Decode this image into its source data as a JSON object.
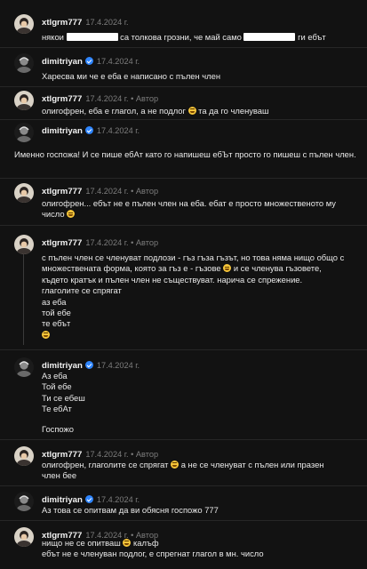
{
  "comments": [
    {
      "user": "xtlgrm777",
      "date": "17.4.2024 г.",
      "author": "",
      "lines": [
        "някои",
        "са толкова грозни, че май само",
        "ги ебът"
      ]
    },
    {
      "user": "dimitriyan",
      "date": "17.4.2024 г.",
      "author": "",
      "lines": [
        "Харесва ми че е еба е написано с пълен член"
      ]
    },
    {
      "user": "xtlgrm777",
      "date": "17.4.2024 г.",
      "author": "• Автор",
      "lines": [
        "олигофрен, еба е глагол, а не подлог",
        "та да го членуваш"
      ]
    },
    {
      "user": "dimitriyan",
      "date": "17.4.2024 г.",
      "author": "",
      "lines": [
        "Именно госпожа! И се пише ебАт като го напишеш ебЪт просто го пишеш с",
        "пълен член."
      ]
    },
    {
      "user": "xtlgrm777",
      "date": "17.4.2024 г.",
      "author": "• Автор",
      "lines": [
        "олигофрен... ебът не е пълен член на еба. ебат е просто множественото му",
        "число"
      ]
    },
    {
      "user": "xtlgrm777",
      "date": "17.4.2024 г.",
      "author": "• Автор",
      "lines": [
        "с пълен член се членуват подлози - гъз гъза гъзът, но това няма нищо общо с",
        "множествената форма, която за гъз е - гъзове",
        "и се членува гъзовете,",
        "където кратък и пълен член не съществуват. нарича се спрежение.",
        "глаголите се спрягат",
        "аз еба",
        "той ебе",
        "те ебът"
      ]
    },
    {
      "user": "dimitriyan",
      "date": "17.4.2024 г.",
      "author": "",
      "lines": [
        "Аз еба",
        "Той ебе",
        "Ти се ебеш",
        "Те ебАт",
        "Госпожо"
      ]
    },
    {
      "user": "xtlgrm777",
      "date": "17.4.2024 г.",
      "author": "• Автор",
      "lines": [
        "олигофрен, глаголите се спрягат",
        "а не се членуват с пълен или празен",
        "член бее"
      ]
    },
    {
      "user": "dimitriyan",
      "date": "17.4.2024 г.",
      "author": "",
      "lines": [
        "Аз това се опитвам да ви обясня госпожо 777"
      ]
    },
    {
      "user": "xtlgrm777",
      "date": "17.4.2024 г.",
      "author": "• Автор",
      "lines": [
        "нищо не се опитваш",
        "калъф",
        "ебът не е членуван подлог, е спрегнат глагол в мн. число"
      ]
    }
  ],
  "colors": {
    "background": "#121212",
    "verified": "#2f86ff",
    "muted": "#7d7d7d"
  }
}
